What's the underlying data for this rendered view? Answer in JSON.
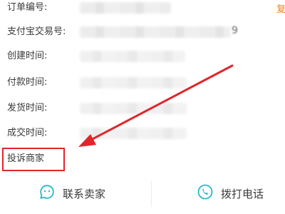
{
  "order_info": {
    "order_number_label": "订单编号:",
    "alipay_trade_label": "支付宝交易号:",
    "alipay_trade_visible_tail": "9",
    "created_time_label": "创建时间:",
    "paid_time_label": "付款时间:",
    "shipped_time_label": "发货时间:",
    "completed_time_label": "成交时间:",
    "copy_label": "复"
  },
  "complaint": {
    "label": "投诉商家"
  },
  "bottom_actions": {
    "contact_seller_label": "联系卖家",
    "call_label": "拨打电话"
  },
  "colors": {
    "accent": "#e8841a",
    "annotation": "#e0262b",
    "icon": "#27b8c8"
  },
  "icons": {
    "contact_seller": "chat-bubble-icon",
    "call": "phone-icon"
  }
}
